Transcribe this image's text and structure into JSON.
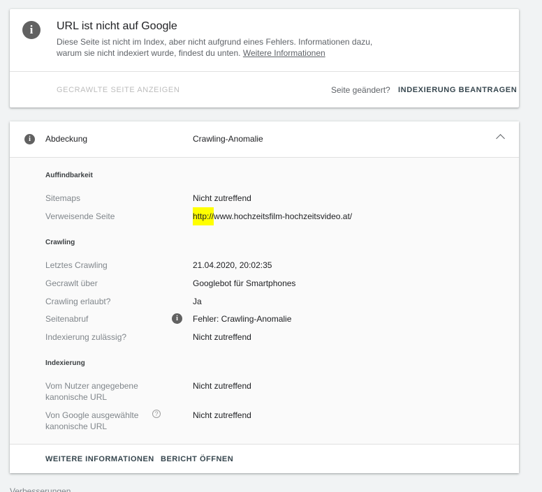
{
  "status_card": {
    "title": "URL ist nicht auf Google",
    "description": "Diese Seite ist nicht im Index, aber nicht aufgrund eines Fehlers. Informationen dazu, warum sie nicht indexiert wurde, findest du unten.",
    "learn_more_link": "Weitere Informationen",
    "view_crawled_button": "GECRAWLTE SEITE ANZEIGEN",
    "page_changed_text": "Seite geändert?",
    "request_indexing_button": "INDEXIERUNG BEANTRAGEN",
    "icon": "info-icon"
  },
  "coverage_card": {
    "header_label": "Abdeckung",
    "header_value": "Crawling-Anomalie",
    "sections": {
      "discovery": {
        "title": "Auffindbarkeit",
        "rows": [
          {
            "label": "Sitemaps",
            "value": "Nicht zutreffend"
          },
          {
            "label": "Verweisende Seite",
            "value_highlight": "http://",
            "value_rest": "www.hochzeitsfilm-hochzeitsvideo.at/"
          }
        ]
      },
      "crawl": {
        "title": "Crawling",
        "rows": [
          {
            "label": "Letztes Crawling",
            "value": "21.04.2020, 20:02:35"
          },
          {
            "label": "Gecrawlt über",
            "value": "Googlebot für Smartphones"
          },
          {
            "label": "Crawling erlaubt?",
            "value": "Ja"
          },
          {
            "label": "Seitenabruf",
            "value": "Fehler: Crawling-Anomalie"
          },
          {
            "label": "Indexierung zulässig?",
            "value": "Nicht zutreffend"
          }
        ]
      },
      "indexing": {
        "title": "Indexierung",
        "rows": [
          {
            "label": "Vom Nutzer angegebene kanonische URL",
            "value": "Nicht zutreffend"
          },
          {
            "label": "Von Google ausgewählte kanonische URL",
            "value": "Nicht zutreffend"
          }
        ]
      }
    },
    "footer": {
      "learn_more_button": "WEITERE INFORMATIONEN",
      "open_report_button": "BERICHT ÖFFNEN"
    }
  },
  "bottom_section_label": "Verbesserungen",
  "colors": {
    "highlight": "#ffff00",
    "background": "#f1f3f4",
    "icon_gray": "#616161"
  }
}
